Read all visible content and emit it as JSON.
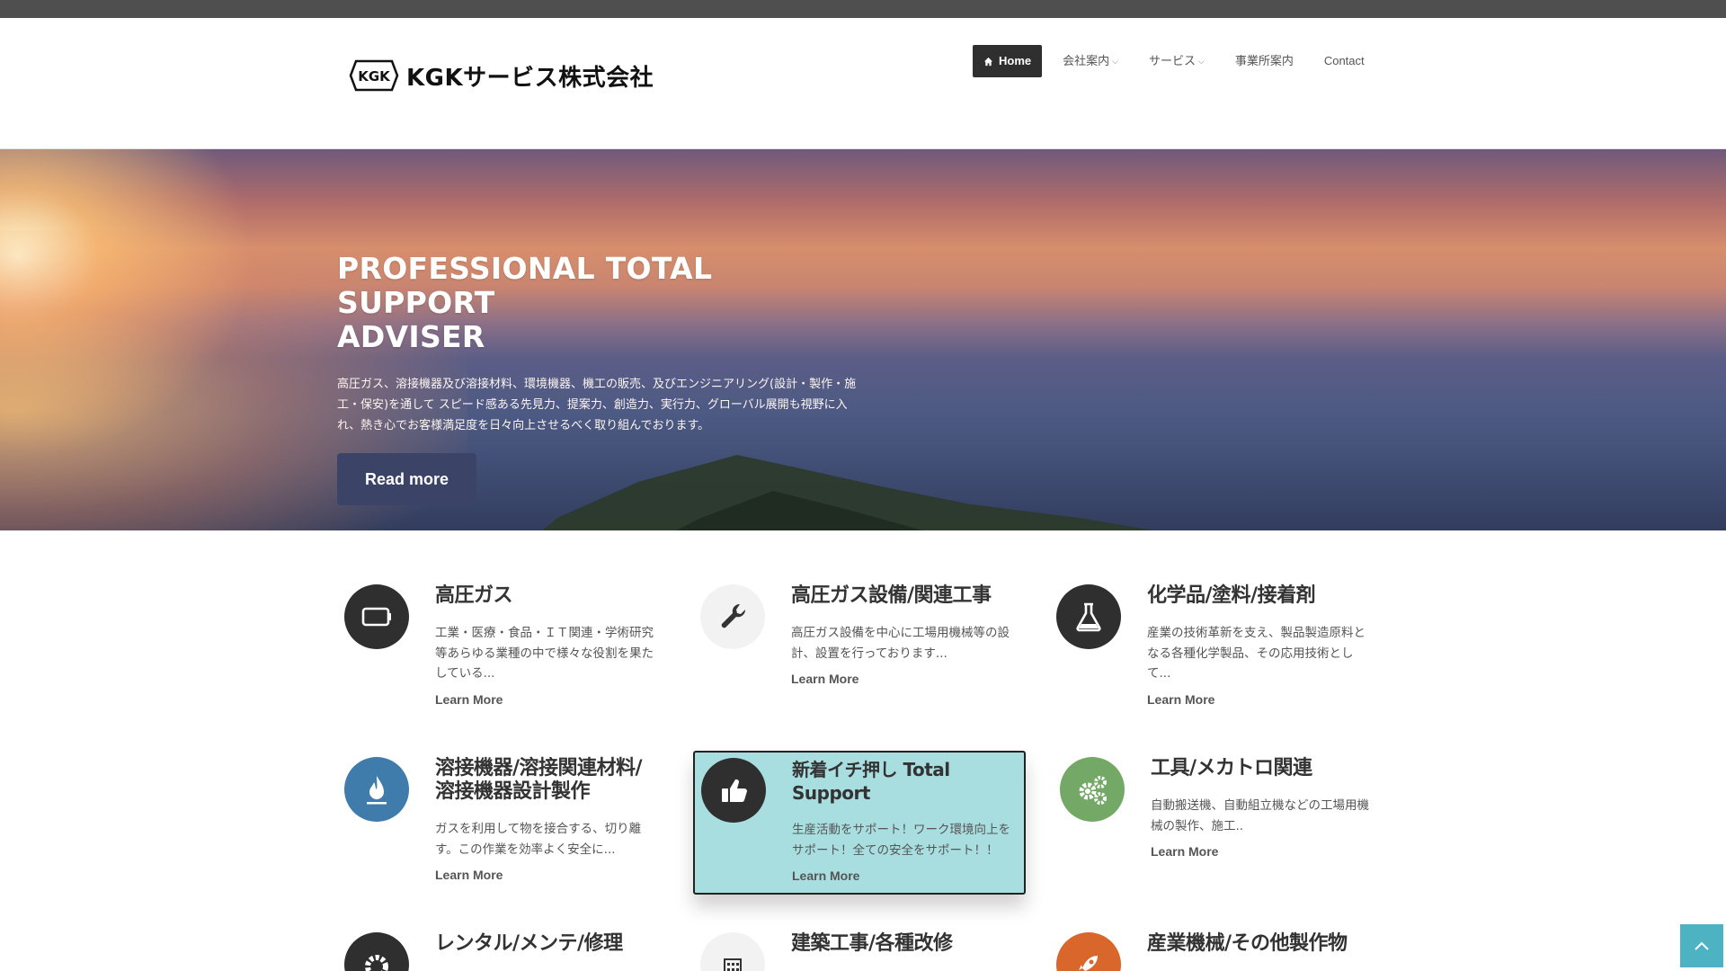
{
  "site": {
    "logo_text": "KGKサービス株式会社",
    "logo_mark_text": "KGK"
  },
  "nav": {
    "items": [
      {
        "label": "Home",
        "active": true
      },
      {
        "label": "会社案内",
        "dropdown": true
      },
      {
        "label": "サービス",
        "dropdown": true
      },
      {
        "label": "事業所案内"
      },
      {
        "label": "Contact"
      }
    ]
  },
  "hero": {
    "title_line1": "PROFESSIONAL TOTAL SUPPORT",
    "title_line2": "ADVISER",
    "text": "高圧ガス、溶接機器及び溶接材料、環境機器、機工の販売、及びエンジニアリング(設計・製作・施工・保安)を通して スピード感ある先見力、提案力、創造力、実行力、グローバル展開も視野に入れ、熱き心でお客様満足度を日々向上させるべく取り組んでおります。",
    "button_label": "Read more"
  },
  "features": [
    {
      "title": "高圧ガス",
      "desc": "工業・医療・食品・ＩＴ関連・学術研究等あらゆる業種の中で様々な役割を果たしている...",
      "link": "Learn More",
      "icon": "battery-icon",
      "color": "#2f2f2f"
    },
    {
      "title": "高圧ガス設備/関連工事",
      "desc": "高圧ガス設備を中心に工場用機械等の設計、設置を行っております...",
      "link": "Learn More",
      "icon": "wrench-icon",
      "color": "#f2f2f2"
    },
    {
      "title": "化学品/塗料/接着剤",
      "desc": "産業の技術革新を支え、製品製造原料となる各種化学製品、その応用技術として...",
      "link": "Learn More",
      "icon": "flask-icon",
      "color": "#2f2f2f"
    },
    {
      "title": "溶接機器/溶接関連材料/溶接機器設計製作",
      "desc": "ガスを利用して物を接合する、切り離す。この作業を効率よく安全に...",
      "link": "Learn More",
      "icon": "flame-icon",
      "color": "#3f7bab"
    },
    {
      "title": "新着イチ押し Total Support",
      "desc": "生産活動をサポート！ワーク環境向上をサポート！全ての安全をサポート！！",
      "link": "Learn More",
      "icon": "thumbs-up-icon",
      "color": "#2f2f2f"
    },
    {
      "title": "工具/メカトロ関連",
      "desc": "自動搬送機、自動組立機などの工場用機械の製作、施工..",
      "link": "Learn More",
      "icon": "gears-icon",
      "color": "#74a866"
    },
    {
      "title": "レンタル/メンテ/修理",
      "desc": "",
      "link": "",
      "icon": "gear-icon",
      "color": "#2f2f2f"
    },
    {
      "title": "建築工事/各種改修",
      "desc": "",
      "link": "",
      "icon": "building-icon",
      "color": "#f2f2f2"
    },
    {
      "title": "産業機械/その他製作物",
      "desc": "",
      "link": "",
      "icon": "rocket-icon",
      "color": "#d9662b"
    }
  ],
  "scroll_top": {
    "icon": "chevron-up-icon"
  }
}
